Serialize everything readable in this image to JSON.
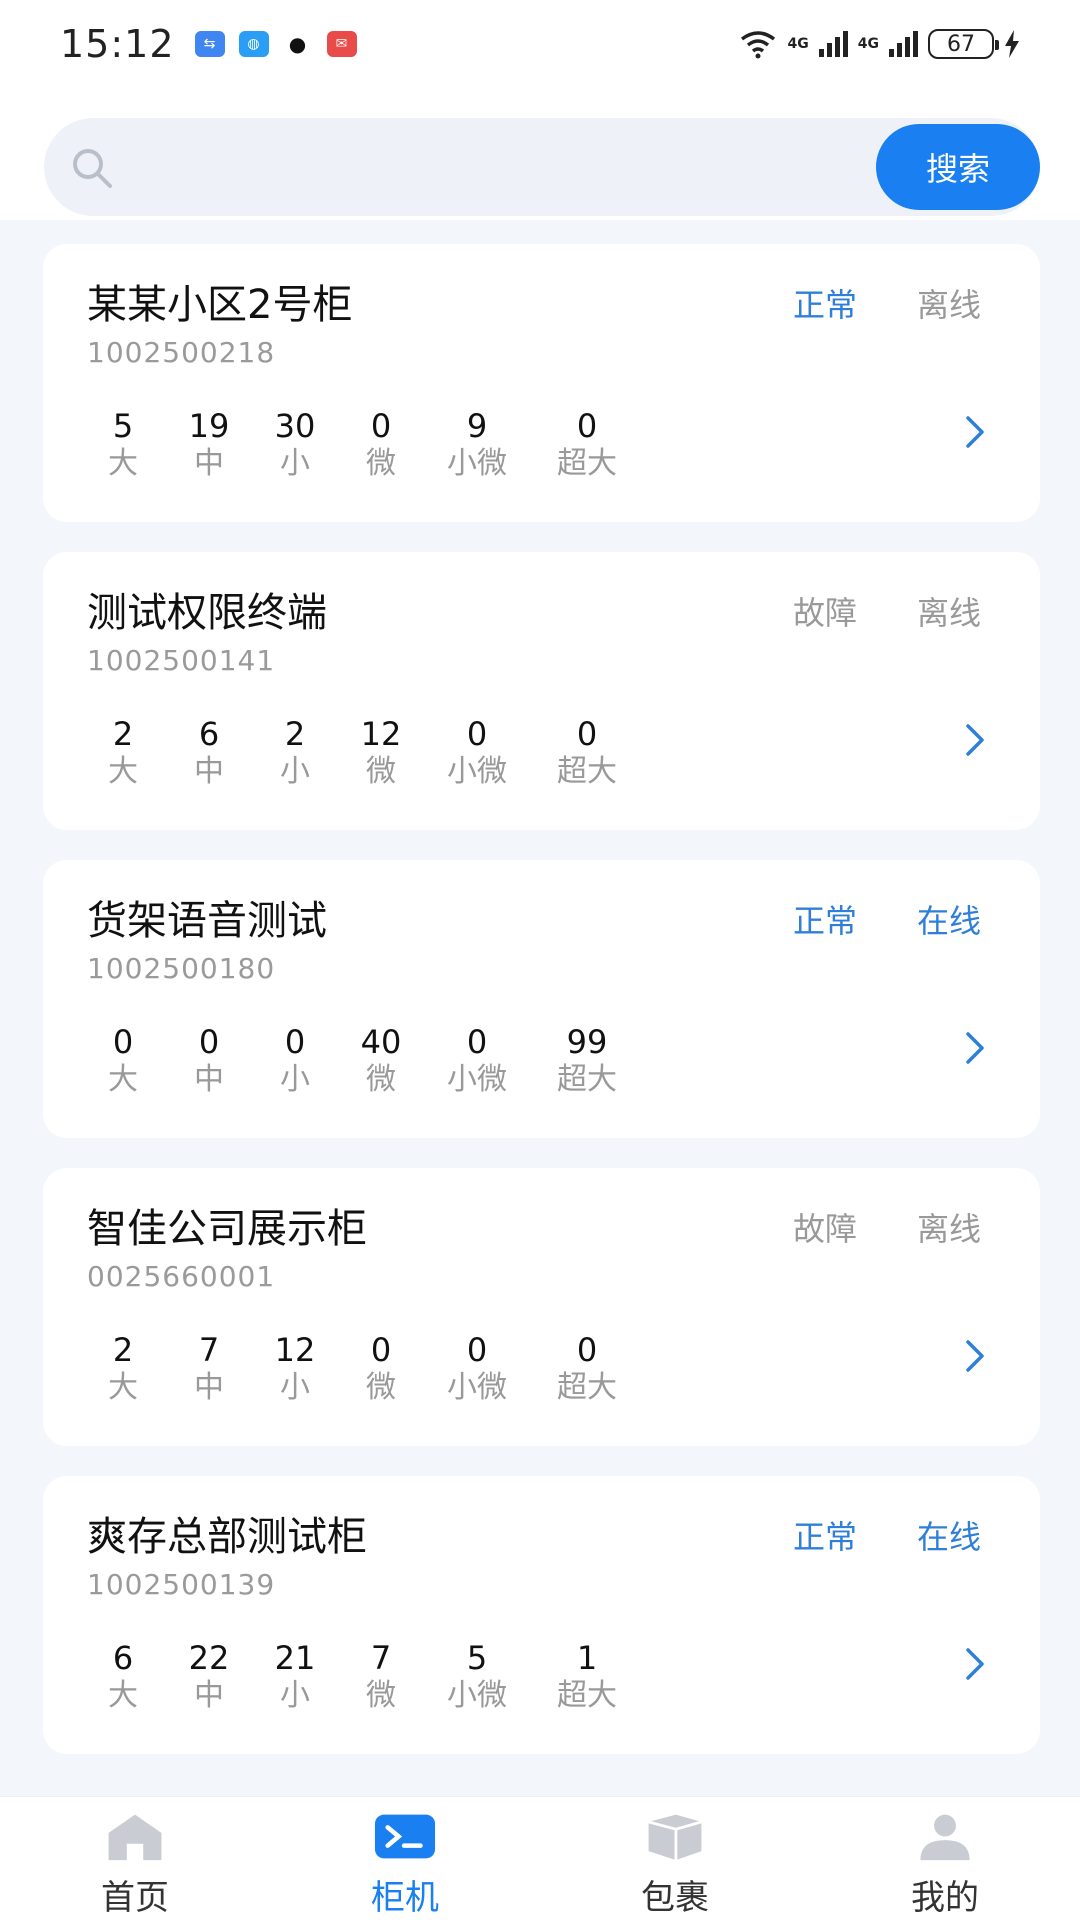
{
  "status_bar": {
    "time": "15:12",
    "network_1": "4G",
    "network_2": "4G",
    "battery": "67"
  },
  "search": {
    "placeholder": "",
    "button_label": "搜索"
  },
  "stat_labels": [
    "大",
    "中",
    "小",
    "微",
    "小微",
    "超大"
  ],
  "cabinets": [
    {
      "name": "某某小区2号柜",
      "code": "1002500218",
      "health": "正常",
      "health_color": "#2f7fd8",
      "online": "离线",
      "online_color": "#999999",
      "counts": [
        "5",
        "19",
        "30",
        "0",
        "9",
        "0"
      ]
    },
    {
      "name": "测试权限终端",
      "code": "1002500141",
      "health": "故障",
      "health_color": "#999999",
      "online": "离线",
      "online_color": "#999999",
      "counts": [
        "2",
        "6",
        "2",
        "12",
        "0",
        "0"
      ]
    },
    {
      "name": "货架语音测试",
      "code": "1002500180",
      "health": "正常",
      "health_color": "#2f7fd8",
      "online": "在线",
      "online_color": "#2f7fd8",
      "counts": [
        "0",
        "0",
        "0",
        "40",
        "0",
        "99"
      ]
    },
    {
      "name": "智佳公司展示柜",
      "code": "0025660001",
      "health": "故障",
      "health_color": "#999999",
      "online": "离线",
      "online_color": "#999999",
      "counts": [
        "2",
        "7",
        "12",
        "0",
        "0",
        "0"
      ]
    },
    {
      "name": "爽存总部测试柜",
      "code": "1002500139",
      "health": "正常",
      "health_color": "#2f7fd8",
      "online": "在线",
      "online_color": "#2f7fd8",
      "counts": [
        "6",
        "22",
        "21",
        "7",
        "5",
        "1"
      ]
    }
  ],
  "tabs": [
    {
      "label": "首页",
      "icon": "home-icon",
      "active": false
    },
    {
      "label": "柜机",
      "icon": "terminal-icon",
      "active": true
    },
    {
      "label": "包裹",
      "icon": "package-icon",
      "active": false
    },
    {
      "label": "我的",
      "icon": "user-icon",
      "active": false
    }
  ],
  "colors": {
    "accent": "#1a7ff0",
    "status_blue": "#2f7fd8",
    "status_gray": "#999999",
    "background": "#f3f6fb"
  }
}
